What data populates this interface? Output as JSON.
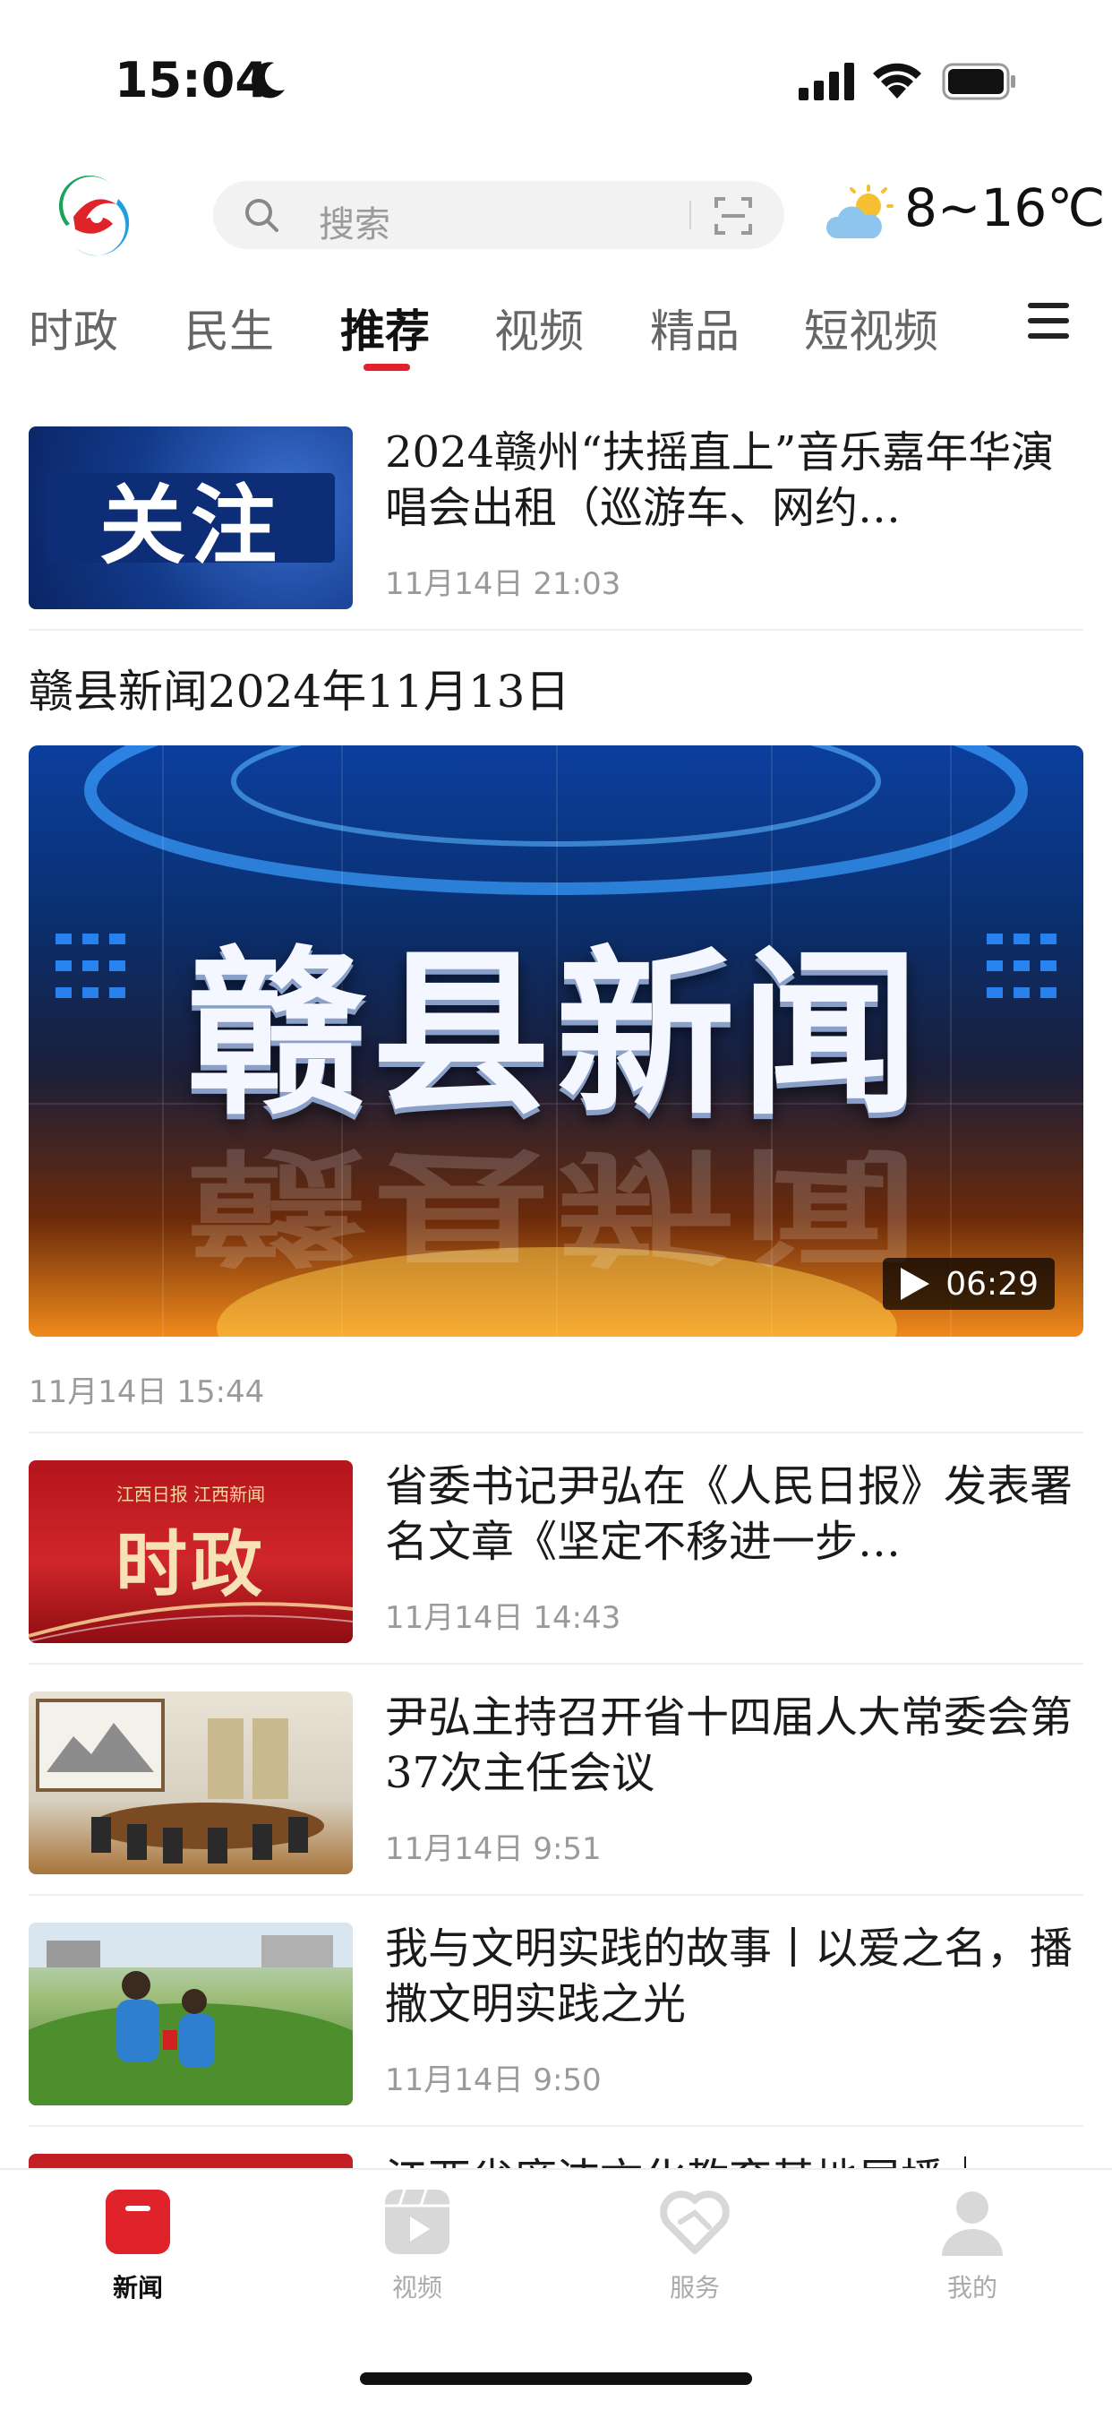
{
  "status_bar": {
    "time": "15:04"
  },
  "header": {
    "search_placeholder": "搜索",
    "temperature": "8~16℃"
  },
  "tabs": [
    {
      "label": "时政"
    },
    {
      "label": "民生"
    },
    {
      "label": "推荐"
    },
    {
      "label": "视频"
    },
    {
      "label": "精品"
    },
    {
      "label": "短视频"
    }
  ],
  "feed": {
    "item1": {
      "thumb_text": "关注",
      "title": "2024赣州“扶摇直上”音乐嘉年华演唱会出租（巡游车、网约…",
      "meta": "11月14日  21:03"
    },
    "video": {
      "title": "赣县新闻2024年11月13日",
      "frame_text": "赣县新闻",
      "duration": "06:29",
      "meta": "11月14日  15:44"
    },
    "item2": {
      "thumb_small_text": "江西日报  江西新闻",
      "thumb_text": "时政",
      "title": "省委书记尹弘在《人民日报》发表署名文章《坚定不移进一步…",
      "meta": "11月14日  14:43"
    },
    "item3": {
      "title": "尹弘主持召开省十四届人大常委会第37次主任会议",
      "meta": "11月14日  9:51"
    },
    "item4": {
      "title": "我与文明实践的故事丨以爱之名，播撒文明实践之光",
      "meta": "11月14日  9:50"
    },
    "item5": {
      "title": "江西省廉洁文化教育基地展播｜"
    }
  },
  "bottom_nav": [
    {
      "label": "新闻"
    },
    {
      "label": "视频"
    },
    {
      "label": "服务"
    },
    {
      "label": "我的"
    }
  ],
  "colors": {
    "accent": "#e0222b",
    "inactive": "#aaaaaa"
  }
}
